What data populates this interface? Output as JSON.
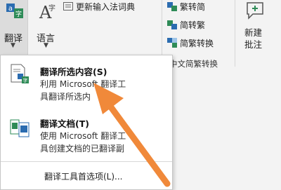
{
  "ribbon": {
    "translate": {
      "label": "翻译",
      "icon": "translate-icon"
    },
    "language": {
      "label": "语言",
      "icon": "language-icon"
    },
    "update_ime_dict": {
      "label": "更新输入法词典",
      "icon": "dictionary-icon"
    },
    "chinese_conversion": {
      "items": [
        {
          "label": "繁转简",
          "icon": "trad-to-simp-icon"
        },
        {
          "label": "简转繁",
          "icon": "simp-to-trad-icon"
        },
        {
          "label": "简繁转换",
          "icon": "simp-trad-convert-icon"
        }
      ],
      "group_label": "中文简繁转换"
    },
    "new_comment": {
      "label_line1": "新建",
      "label_line2": "批注",
      "icon": "new-comment-icon"
    }
  },
  "dropdown": {
    "translate_selection": {
      "title": "翻译所选内容(S)",
      "desc_line1": "利用 Microsoft 翻译工",
      "desc_line2": "具翻译所选内",
      "icon": "translate-selection-icon"
    },
    "translate_document": {
      "title": "翻译文档(T)",
      "desc_line1": "使用 Microsoft 翻译工",
      "desc_line2": "具创建文档的已翻译副",
      "icon": "translate-document-icon"
    },
    "preferences": {
      "label": "翻译工具首选项(L)..."
    }
  },
  "colors": {
    "arrow": "#f0893a",
    "accent_blue": "#2b6cb0",
    "accent_green": "#2e8b57"
  }
}
